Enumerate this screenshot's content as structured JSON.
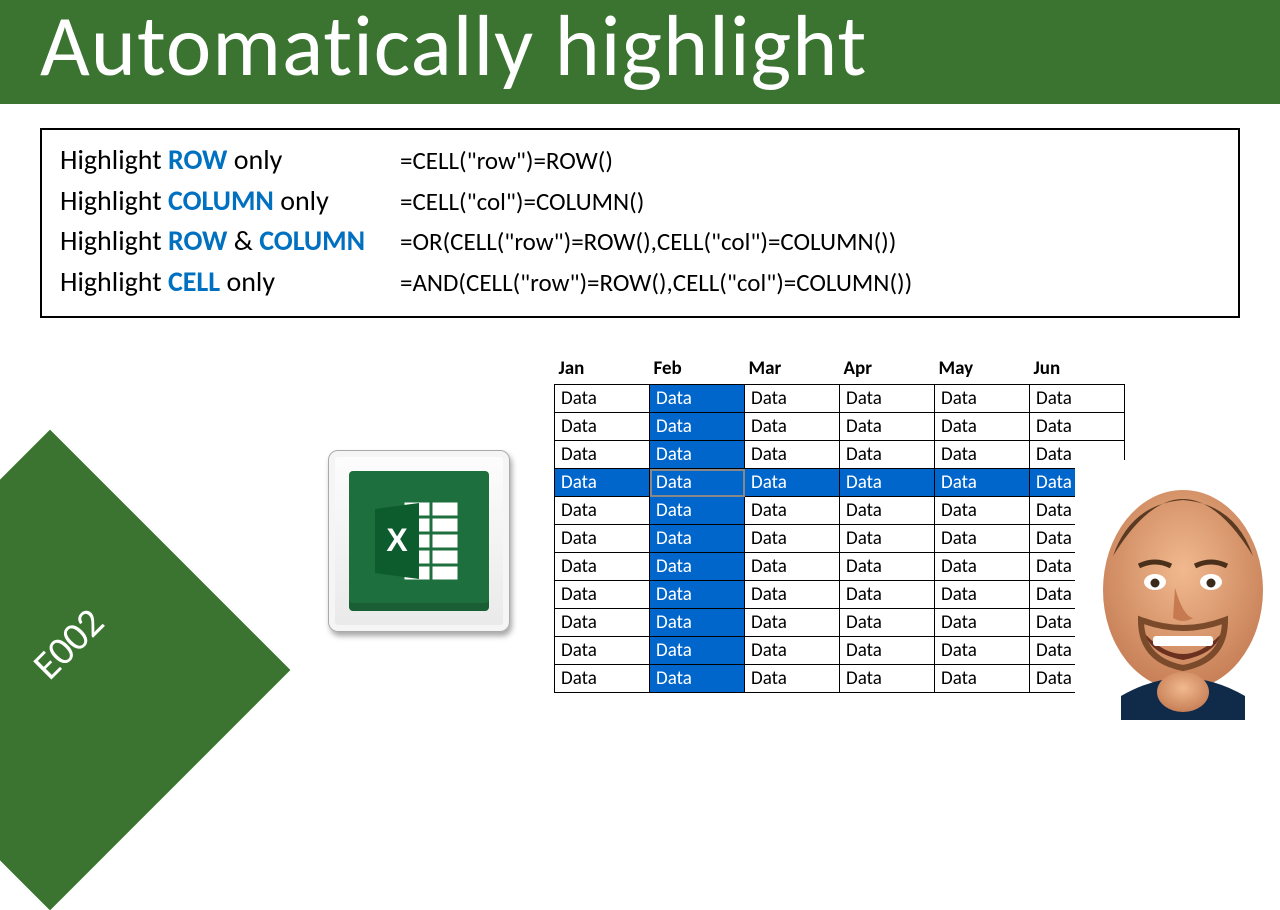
{
  "banner": {
    "title": "Automatically highlight"
  },
  "formulas": [
    {
      "prefix": "Highlight ",
      "hl1": "ROW",
      "mid": " only",
      "hl2": "",
      "suffix": "",
      "code": "=CELL(\"row\")=ROW()"
    },
    {
      "prefix": "Highlight ",
      "hl1": "COLUMN",
      "mid": " only",
      "hl2": "",
      "suffix": "",
      "code": "=CELL(\"col\")=COLUMN()"
    },
    {
      "prefix": "Highlight ",
      "hl1": "ROW",
      "mid": " & ",
      "hl2": "COLUMN",
      "suffix": "",
      "code": "=OR(CELL(\"row\")=ROW(),CELL(\"col\")=COLUMN())"
    },
    {
      "prefix": "Highlight ",
      "hl1": "CELL",
      "mid": " only",
      "hl2": "",
      "suffix": "",
      "code": "=AND(CELL(\"row\")=ROW(),CELL(\"col\")=COLUMN())"
    }
  ],
  "episode": "E002",
  "table": {
    "headers": [
      "Jan",
      "Feb",
      "Mar",
      "Apr",
      "May",
      "Jun"
    ],
    "rows": 11,
    "cell_text": "Data",
    "highlight_row_index": 3,
    "highlight_col_index": 1,
    "active_cell": {
      "row": 3,
      "col": 1
    }
  },
  "icons": {
    "excel_name": "excel-icon"
  }
}
